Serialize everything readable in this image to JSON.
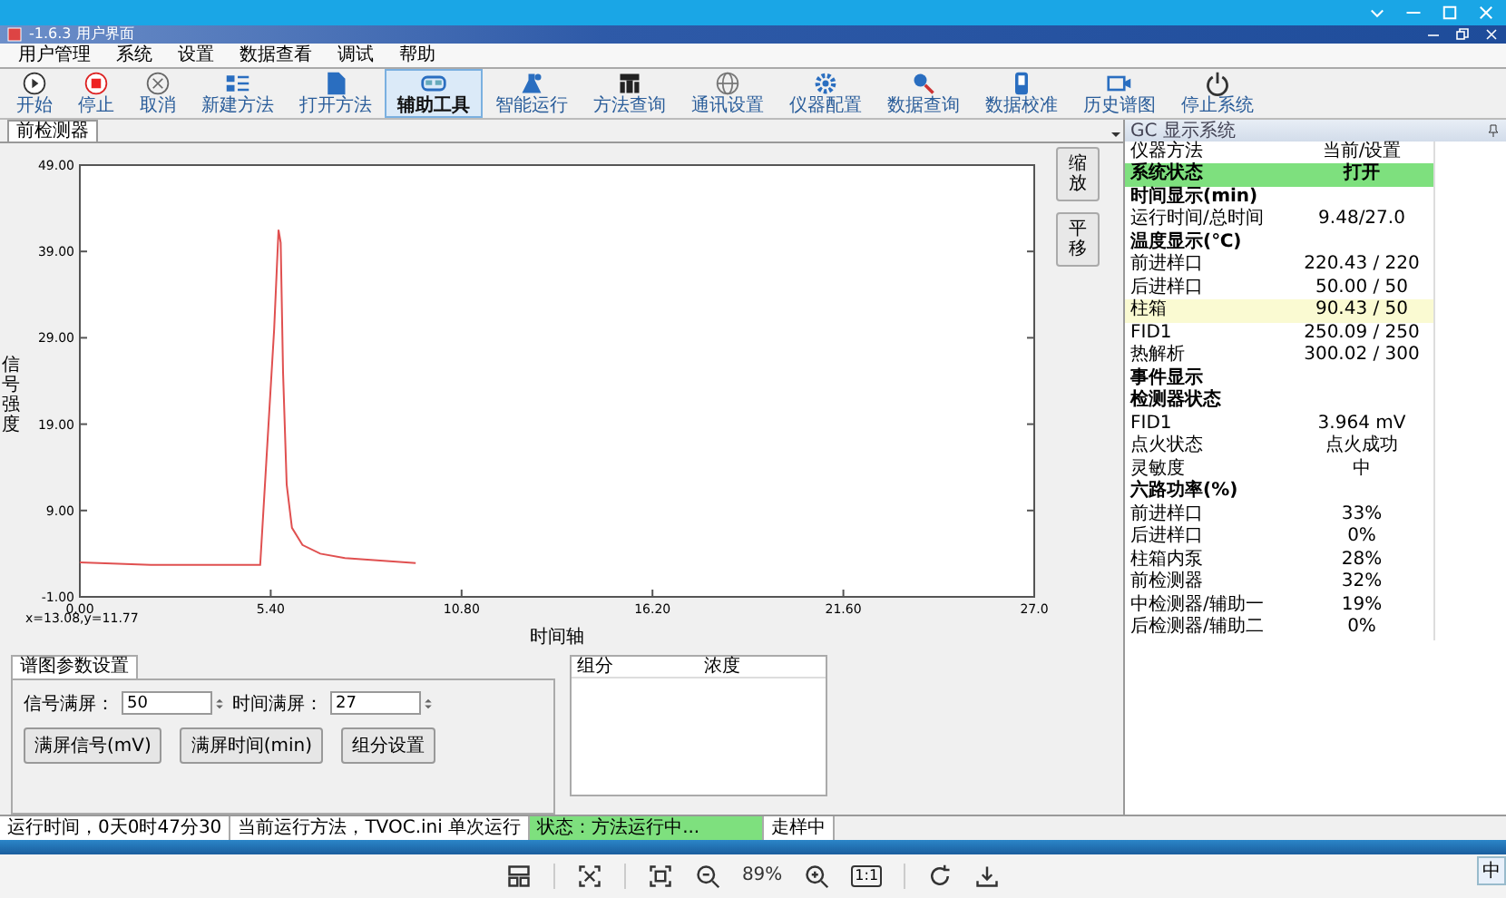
{
  "app": {
    "title": "-1.6.3 用户界面"
  },
  "menu": [
    "用户管理",
    "系统",
    "设置",
    "数据查看",
    "调试",
    "帮助"
  ],
  "toolbar": [
    {
      "label": "开始",
      "selected": false
    },
    {
      "label": "停止",
      "selected": false
    },
    {
      "label": "取消",
      "selected": false
    },
    {
      "label": "新建方法",
      "selected": false
    },
    {
      "label": "打开方法",
      "selected": false
    },
    {
      "label": "辅助工具",
      "selected": true
    },
    {
      "label": "智能运行",
      "selected": false
    },
    {
      "label": "方法查询",
      "selected": false
    },
    {
      "label": "通讯设置",
      "selected": false
    },
    {
      "label": "仪器配置",
      "selected": false
    },
    {
      "label": "数据查询",
      "selected": false
    },
    {
      "label": "数据校准",
      "selected": false
    },
    {
      "label": "历史谱图",
      "selected": false
    },
    {
      "label": "停止系统",
      "selected": false
    }
  ],
  "tabs": [
    {
      "label": "前检测器",
      "selected": true
    }
  ],
  "chart_panel": {
    "coords": "x=13.08,y=11.77",
    "buttons": [
      "缩放",
      "平移"
    ],
    "chart_data": {
      "type": "line",
      "xlabel": "时间轴",
      "ylabel": "信号强度",
      "xlim": [
        0,
        27
      ],
      "ylim": [
        -1,
        49
      ],
      "xticks": [
        {
          "value": 0,
          "label": "0.00"
        },
        {
          "value": 5.4,
          "label": "5.40"
        },
        {
          "value": 10.8,
          "label": "10.80"
        },
        {
          "value": 16.2,
          "label": "16.20"
        },
        {
          "value": 21.6,
          "label": "21.60"
        },
        {
          "value": 27,
          "label": "27.0"
        }
      ],
      "yticks": [
        {
          "value": -1,
          "label": "-1.00"
        },
        {
          "value": 9,
          "label": "9.00"
        },
        {
          "value": 19,
          "label": "19.00"
        },
        {
          "value": 29,
          "label": "29.00"
        },
        {
          "value": 39,
          "label": "39.00"
        },
        {
          "value": 49,
          "label": "49.00"
        }
      ],
      "x": [
        0,
        2,
        5.1,
        5.5,
        5.62,
        5.68,
        5.75,
        5.85,
        6.0,
        6.3,
        6.8,
        7.5,
        8.5,
        9.5
      ],
      "series": [
        {
          "color": "#e05050",
          "values": [
            3.0,
            2.7,
            2.7,
            30,
            41.5,
            40,
            25,
            12,
            7,
            5,
            4,
            3.5,
            3.2,
            2.9
          ]
        }
      ]
    }
  },
  "params": {
    "tab": "谱图参数设置",
    "signal_label": "信号满屏：",
    "signal_value": "50",
    "time_label": "时间满屏：",
    "time_value": "27",
    "buttons": [
      "满屏信号(mV)",
      "满屏时间(min)",
      "组分设置"
    ]
  },
  "components_table": {
    "columns": [
      "组分",
      "浓度"
    ]
  },
  "gc_panel": {
    "title": "GC 显示系统",
    "rows": [
      {
        "kind": "header",
        "label": "仪器方法",
        "value": "当前/设置"
      },
      {
        "kind": "row",
        "label": "系统状态",
        "value": "打开",
        "color": "#7ee07e"
      },
      {
        "kind": "section",
        "label": "时间显示(min)"
      },
      {
        "kind": "row",
        "label": "运行时间/总时间",
        "value": "9.48/27.0"
      },
      {
        "kind": "section",
        "label": "温度显示(℃)"
      },
      {
        "kind": "row",
        "label": "前进样口",
        "value": "220.43 / 220"
      },
      {
        "kind": "row",
        "label": "后进样口",
        "value": "50.00 / 50"
      },
      {
        "kind": "row",
        "label": "柱箱",
        "value": "90.43 / 50",
        "color": "#fafad2"
      },
      {
        "kind": "row",
        "label": "FID1",
        "value": "250.09 / 250"
      },
      {
        "kind": "row",
        "label": "热解析",
        "value": "300.02 / 300"
      },
      {
        "kind": "section",
        "label": "事件显示"
      },
      {
        "kind": "section",
        "label": "检测器状态"
      },
      {
        "kind": "row",
        "label": "FID1",
        "value": "3.964 mV"
      },
      {
        "kind": "row",
        "label": "点火状态",
        "value": "点火成功"
      },
      {
        "kind": "row",
        "label": "灵敏度",
        "value": "中"
      },
      {
        "kind": "section",
        "label": "六路功率(%)"
      },
      {
        "kind": "row",
        "label": "前进样口",
        "value": "33%"
      },
      {
        "kind": "row",
        "label": "后进样口",
        "value": "0%"
      },
      {
        "kind": "row",
        "label": "柱箱内泵",
        "value": "28%"
      },
      {
        "kind": "row",
        "label": "前检测器",
        "value": "32%"
      },
      {
        "kind": "row",
        "label": "中检测器/辅助一",
        "value": "19%"
      },
      {
        "kind": "row",
        "label": "后检测器/辅助二",
        "value": "0%"
      }
    ]
  },
  "status_bar": [
    {
      "text": "运行时间，0天0时47分30"
    },
    {
      "text": "当前运行方法，TVOC.ini 单次运行"
    },
    {
      "text": "状态：方法运行中...",
      "color": "#7ee07e"
    },
    {
      "text": "走样中"
    }
  ],
  "viewer_toolbar": {
    "zoom": "89%",
    "actual_size": "1:1",
    "ime": "中"
  }
}
